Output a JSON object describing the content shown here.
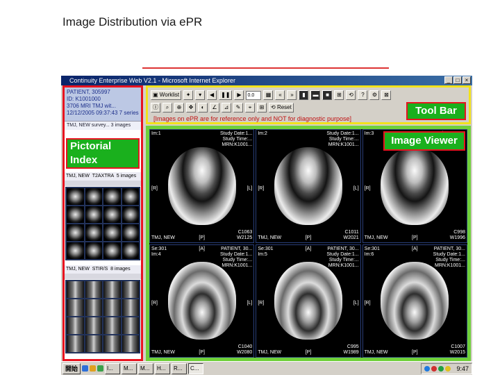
{
  "slide": {
    "title": "Image Distribution via ePR"
  },
  "window": {
    "title": "Continuity Enterprise Web V2.1 - Microsoft Internet Explorer"
  },
  "left_panel": {
    "patient_name": "PATIENT, 305997",
    "patient_id": "ID: K1001000",
    "study_line_1": "3706 MRI TMJ wit...",
    "study_line_2": "12/12/2005 09:37:43",
    "study_count": "7 series",
    "row_modality": "TMJ, NEW",
    "row_desc": "survey...",
    "row_count": "3 images",
    "series_1": {
      "label": "TMJ, NEW",
      "desc": "T2AXTRA",
      "count": "5 images"
    },
    "series_2": {
      "label": "TMJ, NEW",
      "desc": "STIR/S",
      "count": "8 images"
    }
  },
  "annotations": {
    "pictorial_index": "Pictorial Index",
    "tool_bar": "Tool Bar",
    "image_viewer": "Image Viewer"
  },
  "toolbar": {
    "worklist": "Worklist",
    "zoom_value": "0.0",
    "reset": "Reset",
    "notice": "[Images on ePR are for reference only and NOT for diagnostic purpose]",
    "icons": [
      "worklist-icon",
      "window-level-icon",
      "cine-icon",
      "prev-icon",
      "play-icon",
      "pause-icon",
      "next-icon",
      "layout-icon",
      "zoom-icon",
      "pan-icon",
      "measure-icon",
      "help-icon",
      "settings-icon",
      "close-icon"
    ]
  },
  "viewer": {
    "cells": [
      {
        "tl": "Im:1",
        "tr1": "Study Date:1...",
        "tr2": "Study Time:...",
        "tr3": "MRN:K1001...",
        "left": "[R]",
        "right": "[L]",
        "top": "",
        "bottom": "[P]",
        "bl": "TMJ, NEW",
        "br1": "C1063",
        "br2": "W2125"
      },
      {
        "tl": "Im:2",
        "tr1": "Study Date:1...",
        "tr2": "Study Time:...",
        "tr3": "MRN:K1001...",
        "left": "[R]",
        "right": "[L]",
        "top": "",
        "bottom": "[P]",
        "bl": "TMJ, NEW",
        "br1": "C1011",
        "br2": "W2021"
      },
      {
        "tl": "Im:3",
        "tr1": "Study Date:1...",
        "tr2": "Study Time:...",
        "tr3": "MRN:K1001...",
        "left": "[R]",
        "right": "",
        "top": "",
        "bottom": "[P]",
        "bl": "TMJ, NEW",
        "br1": "C998",
        "br2": "W1996"
      },
      {
        "tl": "Se:301",
        "tl2": "Im:4",
        "tr0": "PATIENT, 30...",
        "tr1": "Study Date:1...",
        "tr2": "Study Time:...",
        "tr3": "MRN:K1001...",
        "left": "[R]",
        "right": "[L]",
        "top": "[A]",
        "bottom": "[P]",
        "bl": "TMJ, NEW",
        "br1": "C1040",
        "br2": "W2080"
      },
      {
        "tl": "Se:301",
        "tl2": "Im:5",
        "tr0": "PATIENT, 30...",
        "tr1": "Study Date:1...",
        "tr2": "Study Time:...",
        "tr3": "MRN:K1001...",
        "left": "[R]",
        "right": "[L]",
        "top": "[A]",
        "bottom": "[P]",
        "bl": "TMJ, NEW",
        "br1": "C995",
        "br2": "W1989"
      },
      {
        "tl": "Se:301",
        "tl2": "Im:6",
        "tr0": "PATIENT, 30...",
        "tr1": "Study Date:1...",
        "tr2": "Study Time:...",
        "tr3": "MRN:K1001...",
        "left": "[R]",
        "right": "",
        "top": "[A]",
        "bottom": "[P]",
        "bl": "TMJ, NEW",
        "br1": "C1007",
        "br2": "W2015"
      }
    ]
  },
  "taskbar": {
    "start": "開始",
    "tasks": [
      "I...",
      "M...",
      "M...",
      "H...",
      "R...",
      "C..."
    ],
    "clock": "9:47"
  }
}
